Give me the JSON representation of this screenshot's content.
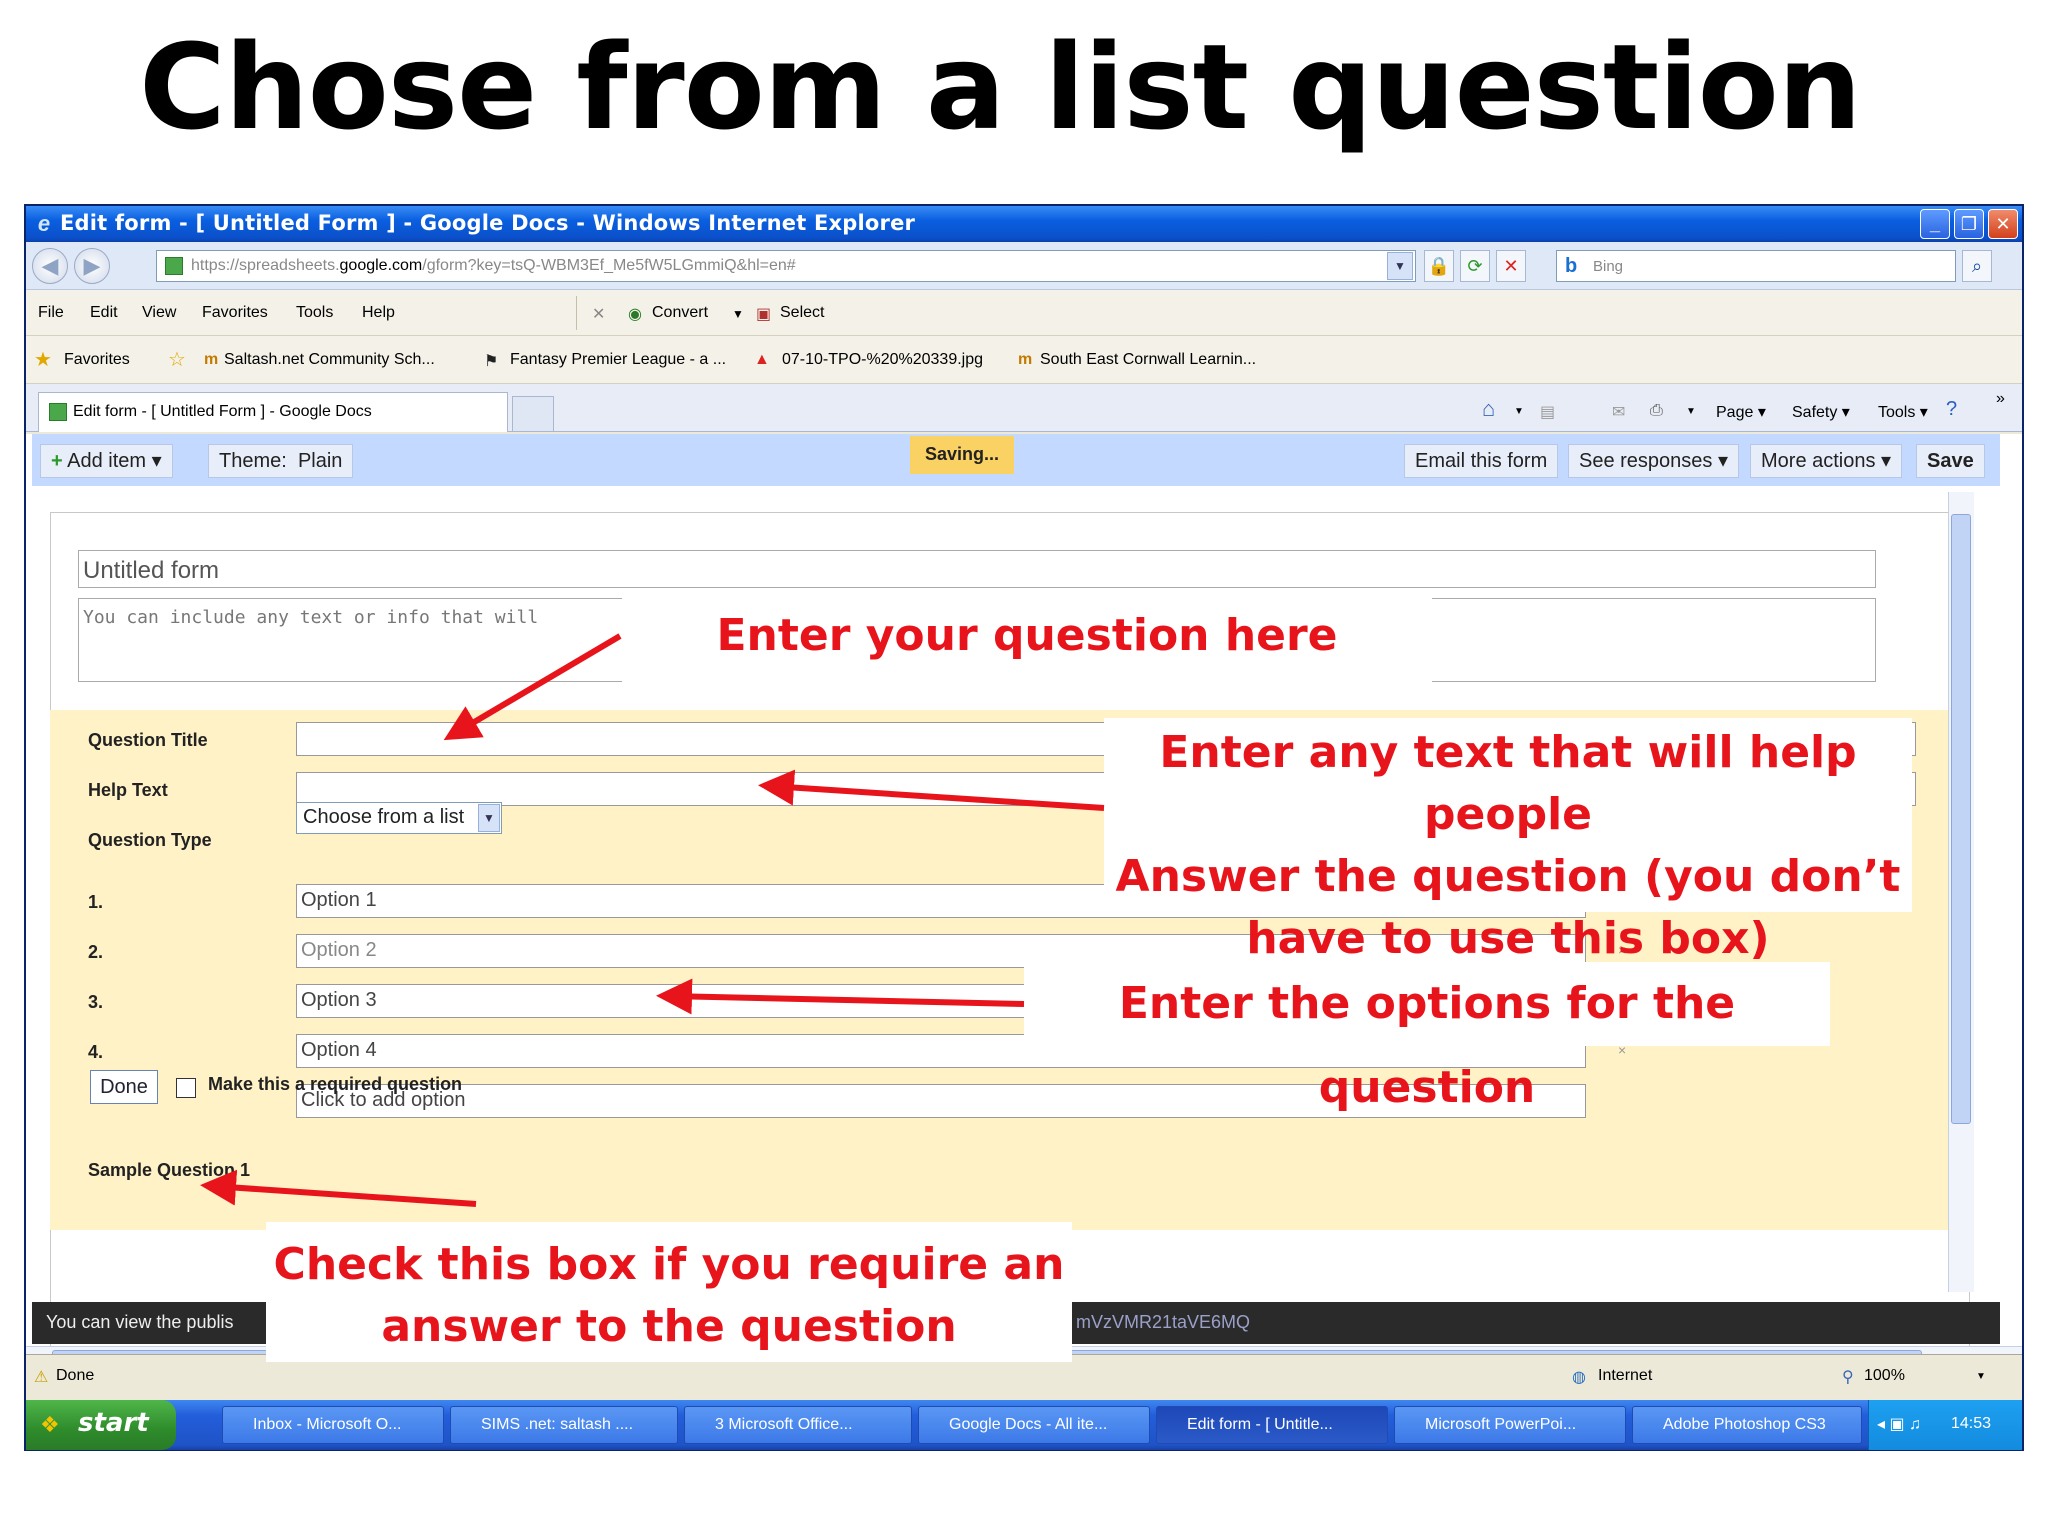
{
  "slide_title": "Chose from a list question",
  "window": {
    "title": "Edit form - [ Untitled Form ] - Google Docs - Windows Internet Explorer",
    "url_prefix": "https://spreadsheets.",
    "url_domain": "google.com",
    "url_rest": "/gform?key=tsQ-WBM3Ef_Me5fW5LGmmiQ&hl=en#",
    "search_placeholder": "Bing"
  },
  "menu": {
    "items": [
      "File",
      "Edit",
      "View",
      "Favorites",
      "Tools",
      "Help"
    ],
    "convert": "Convert",
    "select": "Select"
  },
  "favorites": {
    "label": "Favorites",
    "links": [
      "Saltash.net Community Sch...",
      "Fantasy Premier League - a ...",
      "07-10-TPO-%20%20339.jpg",
      "South East Cornwall Learnin..."
    ]
  },
  "tab": {
    "label": "Edit form - [ Untitled Form ] - Google Docs"
  },
  "command_bar": {
    "page": "Page",
    "safety": "Safety",
    "tools": "Tools"
  },
  "gdocs": {
    "add_item": "Add item",
    "theme_label": "Theme:",
    "theme_value": "Plain",
    "saving": "Saving...",
    "email_form": "Email this form",
    "see_responses": "See responses",
    "more_actions": "More actions",
    "save": "Save"
  },
  "form": {
    "title": "Untitled form",
    "description": "You can include any text or info that will",
    "question_title_label": "Question Title",
    "help_text_label": "Help Text",
    "question_type_label": "Question Type",
    "question_type_value": "Choose from a list",
    "options": [
      {
        "num": "1.",
        "value": "Option 1"
      },
      {
        "num": "2.",
        "value": "Option 2"
      },
      {
        "num": "3.",
        "value": "Option 3"
      },
      {
        "num": "4.",
        "value": "Option 4"
      }
    ],
    "add_option": "Click to add option",
    "done": "Done",
    "required_label": "Make this a required question",
    "sample_question": "Sample Question 1"
  },
  "bottom_bar": {
    "text_left": "You can view the publis",
    "text_right": "mVzVMR21taVE6MQ"
  },
  "status": {
    "done": "Done",
    "zone": "Internet",
    "zoom": "100%"
  },
  "taskbar": {
    "start": "start",
    "items": [
      "Inbox - Microsoft O...",
      "SIMS .net: saltash ....",
      "3 Microsoft Office...",
      "Google Docs - All ite...",
      "Edit form - [ Untitle...",
      "Microsoft PowerPoi...",
      "Adobe Photoshop CS3"
    ],
    "clock": "14:53"
  },
  "annotations": {
    "question": "Enter your question here",
    "help_line1": "Enter any text that will help people",
    "help_line2": "Answer the question (you don’t",
    "help_line3": "have to use this box)",
    "options": "Enter the options for the question",
    "required_line1": "Check this box if you require an",
    "required_line2": "answer to the question"
  },
  "colors": {
    "annotation_red": "#e8141b",
    "edit_panel": "#fff2c7",
    "gdocs_bar": "#c3d9ff",
    "saving_badge": "#fad163"
  }
}
